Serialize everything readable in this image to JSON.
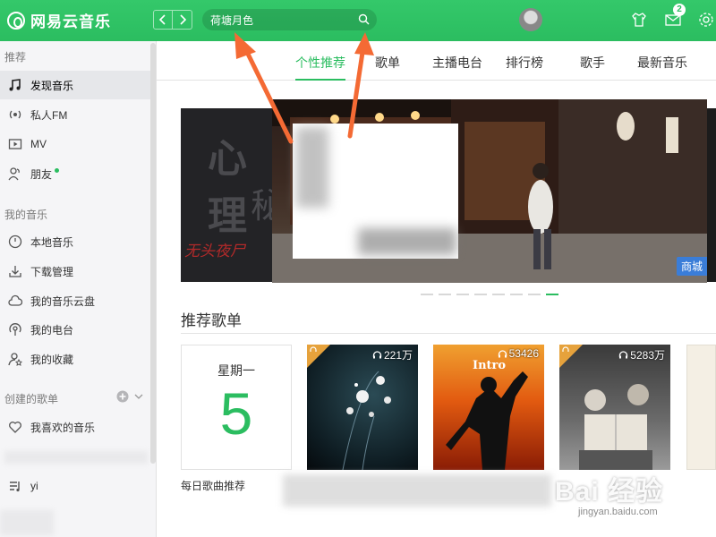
{
  "app": {
    "logo_text": "网易云音乐",
    "accent_color": "#2bbd60"
  },
  "topbar": {
    "back_icon": "chevron-left-icon",
    "forward_icon": "chevron-right-icon",
    "search_value": "荷塘月色",
    "search_icon": "search-icon",
    "message_badge": "2",
    "icons": [
      "shirt-icon",
      "mail-icon",
      "gear-icon"
    ]
  },
  "sidebar": {
    "section_recommend": "推荐",
    "recommend_items": [
      {
        "label": "发现音乐",
        "icon": "music-note-icon",
        "active": true
      },
      {
        "label": "私人FM",
        "icon": "radio-icon"
      },
      {
        "label": "MV",
        "icon": "video-icon"
      },
      {
        "label": "朋友",
        "icon": "friends-icon",
        "dot": true
      }
    ],
    "section_my_music": "我的音乐",
    "my_music_items": [
      {
        "label": "本地音乐",
        "icon": "disc-icon"
      },
      {
        "label": "下载管理",
        "icon": "download-icon"
      },
      {
        "label": "我的音乐云盘",
        "icon": "cloud-icon"
      },
      {
        "label": "我的电台",
        "icon": "podcast-icon"
      },
      {
        "label": "我的收藏",
        "icon": "star-user-icon"
      }
    ],
    "section_created": "创建的歌单",
    "created_items": [
      {
        "label": "我喜欢的音乐",
        "icon": "heart-icon"
      },
      {
        "label": "yi",
        "icon": "playlist-icon"
      }
    ]
  },
  "tabs": [
    {
      "label": "个性推荐",
      "active": true
    },
    {
      "label": "歌单"
    },
    {
      "label": "主播电台"
    },
    {
      "label": "排行榜"
    },
    {
      "label": "歌手"
    },
    {
      "label": "最新音乐"
    }
  ],
  "banner": {
    "left_title": "心理",
    "left_title2": "秘",
    "left_subtitle": "无头夜尸",
    "shop_tag": "商城",
    "dot_count": 8,
    "active_dot": 7
  },
  "recommend": {
    "title": "推荐歌单",
    "daily": {
      "weekday": "星期一",
      "day": "5",
      "caption": "每日歌曲推荐"
    },
    "playlists": [
      {
        "count": "221万",
        "theme": "flowers"
      },
      {
        "count": "53426",
        "title_on_cover": "Intro",
        "theme": "guitar"
      },
      {
        "count": "5283万",
        "theme": "children"
      }
    ]
  },
  "watermark": {
    "main": "Bai 经验",
    "sub": "jingyan.baidu.com"
  }
}
